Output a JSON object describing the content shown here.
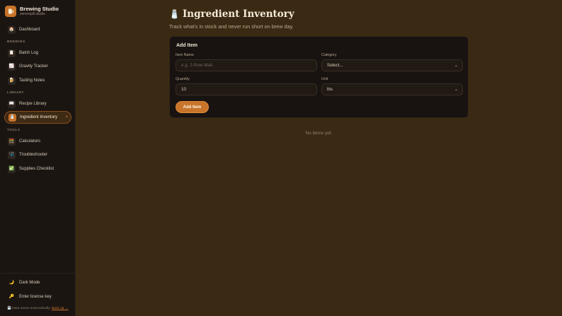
{
  "brand": {
    "title": "Brewing Studio",
    "subtitle": "zenempill.studio",
    "logo_icon": "beer-mug-icon"
  },
  "sidebar": {
    "sections": {
      "brewing": "BREWING",
      "library": "LIBRARY",
      "tools": "TOOLS"
    },
    "items": [
      {
        "label": "Dashboard",
        "icon": "house-icon",
        "glyph": "🏠"
      },
      {
        "label": "Batch Log",
        "icon": "clipboard-icon",
        "glyph": "📋"
      },
      {
        "label": "Gravity Tracker",
        "icon": "chart-icon",
        "glyph": "📈"
      },
      {
        "label": "Tasting Notes",
        "icon": "beer-icon",
        "glyph": "🍺"
      },
      {
        "label": "Recipe Library",
        "icon": "book-icon",
        "glyph": "📖"
      },
      {
        "label": "Ingredient Inventory",
        "icon": "salt-shaker-icon",
        "glyph": "🧂",
        "active": true
      },
      {
        "label": "Calculators",
        "icon": "calculator-icon",
        "glyph": "🧮"
      },
      {
        "label": "Troubleshooter",
        "icon": "stethoscope-icon",
        "glyph": "🩺"
      },
      {
        "label": "Supplies Checklist",
        "icon": "check-icon",
        "glyph": "✅"
      }
    ],
    "footer_items": [
      {
        "label": "Dark Mode",
        "icon": "moon-icon",
        "glyph": "🌙"
      },
      {
        "label": "Enter license key",
        "icon": "key-icon",
        "glyph": "🔑"
      }
    ],
    "footer_note": {
      "text": "💾 Data saves automatically.",
      "link": "Back up →"
    }
  },
  "page": {
    "title_glyph": "🧂",
    "title": "Ingredient Inventory",
    "subtitle": "Track what's in stock and never run short on brew day."
  },
  "form": {
    "title": "Add Item",
    "item_name_label": "Item Name",
    "item_name_placeholder": "e.g. 2-Row Malt",
    "category_label": "Category",
    "category_value": "Select...",
    "quantity_label": "Quantity",
    "quantity_value": "10",
    "unit_label": "Unit",
    "unit_value": "lbs",
    "add_button": "Add Item"
  },
  "empty_text": "No items yet.",
  "colors": {
    "accent": "#c8742a",
    "background": "#3b2a13",
    "sidebar": "#1b1512",
    "card": "#181310"
  }
}
